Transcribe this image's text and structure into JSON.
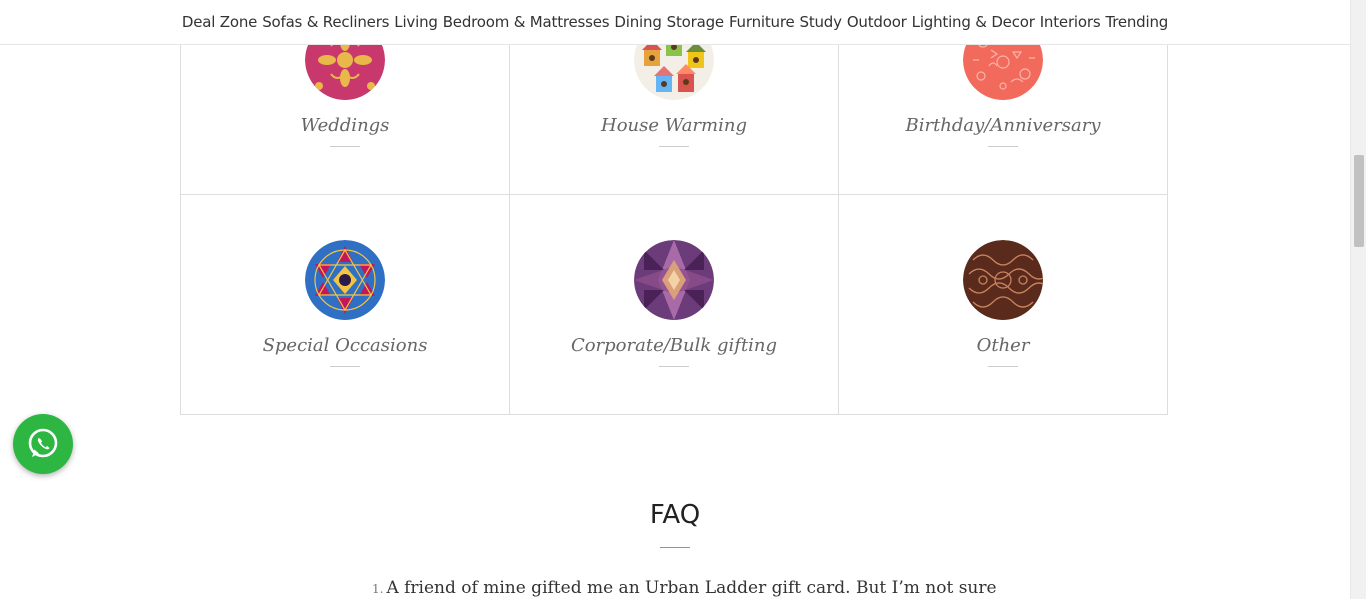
{
  "nav": {
    "items": [
      "Deal Zone",
      "Sofas & Recliners",
      "Living",
      "Bedroom & Mattresses",
      "Dining",
      "Storage",
      "Furniture",
      "Study",
      "Outdoor",
      "Lighting & Decor",
      "Interiors",
      "Trending"
    ]
  },
  "occasions": [
    {
      "label": "Weddings",
      "icon": "wedding-pattern",
      "color": "#c8386d"
    },
    {
      "label": "House Warming",
      "icon": "birdhouse-pattern",
      "color": "#f3efe6"
    },
    {
      "label": "Birthday/Anniversary",
      "icon": "doodle-pattern",
      "color": "#f26a5c"
    },
    {
      "label": "Special Occasions",
      "icon": "kaleidoscope-pattern",
      "color": "#2f6fc4"
    },
    {
      "label": "Corporate/Bulk gifting",
      "icon": "purple-kaleidoscope-pattern",
      "color": "#6b3b7a"
    },
    {
      "label": "Other",
      "icon": "brown-ornament-pattern",
      "color": "#5a2a1c"
    }
  ],
  "whatsapp": {
    "icon": "whatsapp-icon",
    "color": "#2db742"
  },
  "faq": {
    "title": "FAQ",
    "accent": "#e27c3b",
    "questions": [
      {
        "number": "1.",
        "text": "A friend of mine gifted me an Urban Ladder gift card. But I’m not sure"
      }
    ]
  }
}
